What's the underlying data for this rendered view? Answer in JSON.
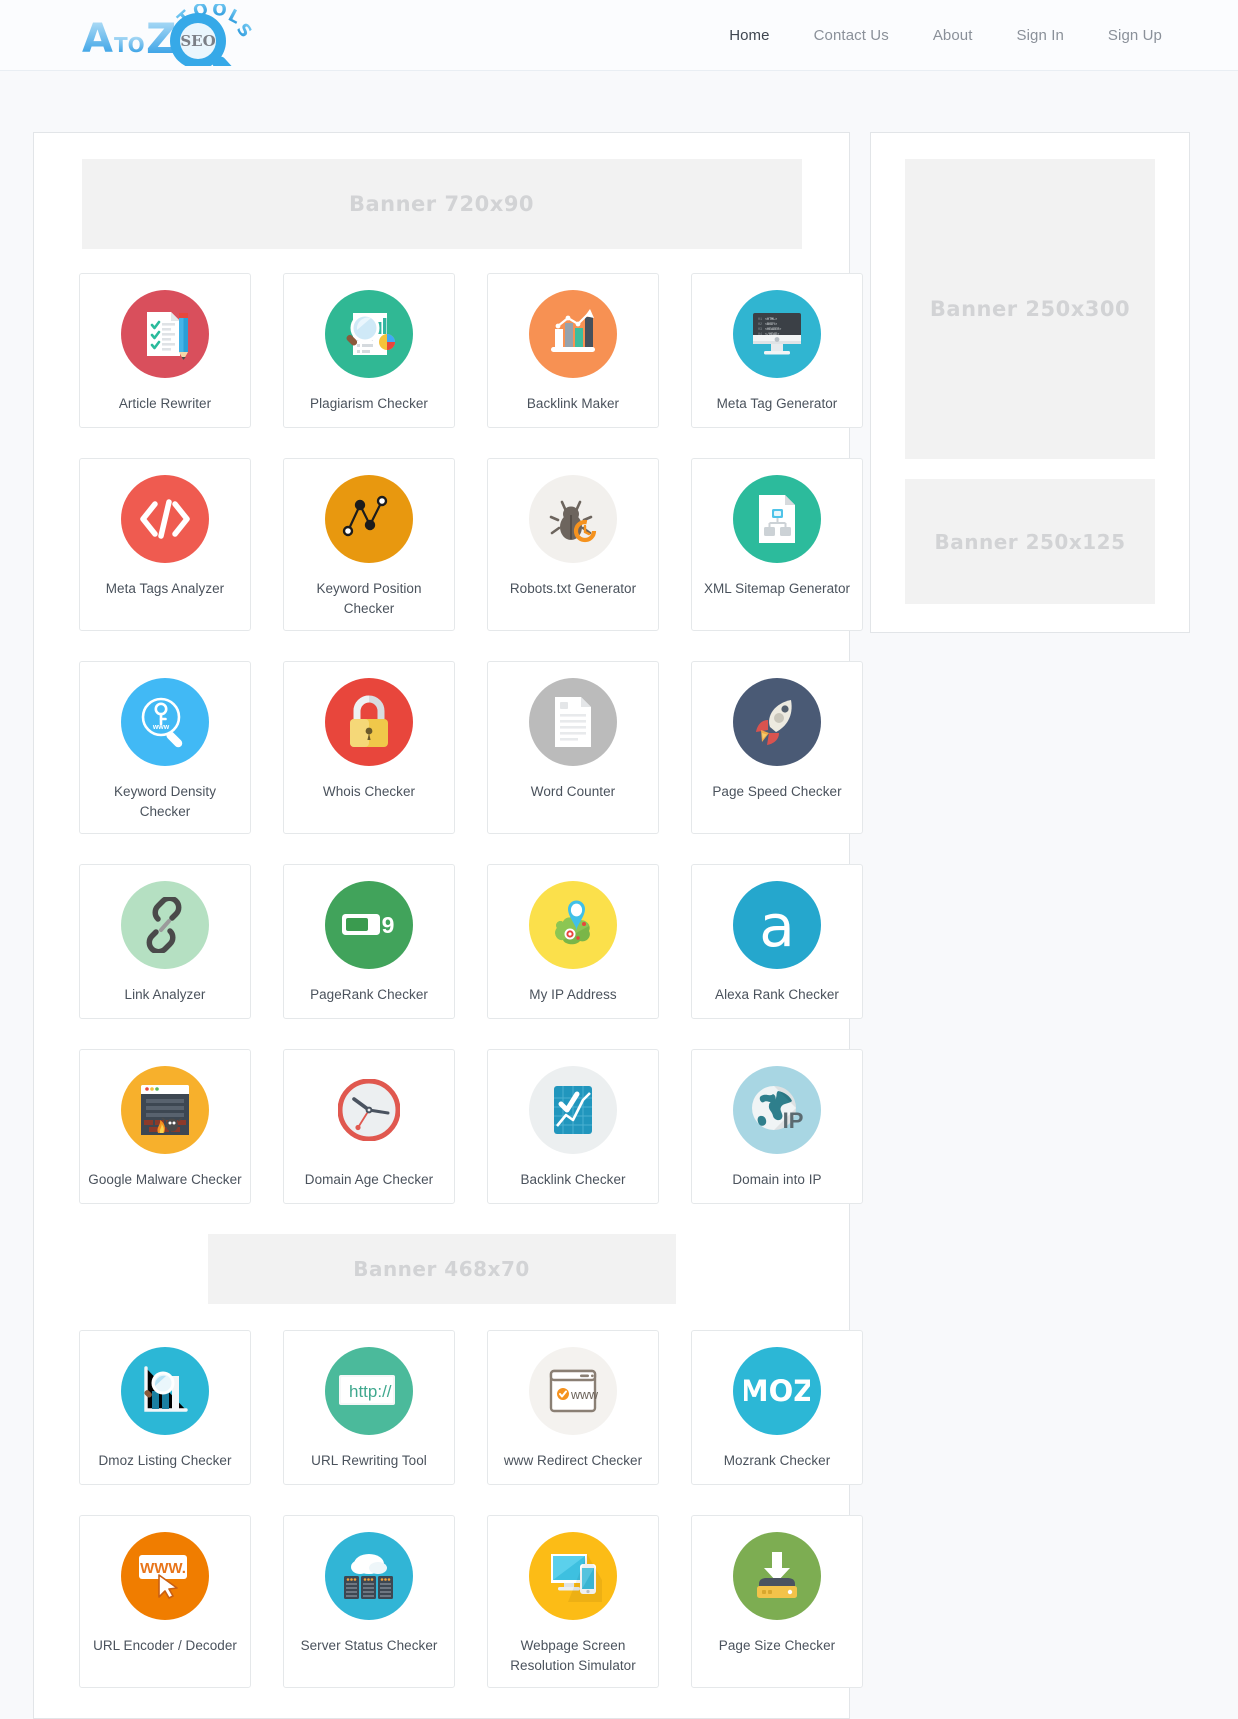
{
  "header": {
    "logo": {
      "alt": "A to Z SEO Tools",
      "text_a": "A",
      "text_to": "TO",
      "text_z": "Z",
      "badge": "SEO",
      "text_tools": "TOOLS"
    },
    "nav": [
      {
        "label": "Home",
        "active": true
      },
      {
        "label": "Contact Us",
        "active": false
      },
      {
        "label": "About",
        "active": false
      },
      {
        "label": "Sign In",
        "active": false
      },
      {
        "label": "Sign Up",
        "active": false
      }
    ],
    "accent_color": "#2cb5cd"
  },
  "main": {
    "banner_top": "Banner  720x90",
    "banner_mid": "Banner  468x70",
    "tools_group_1": [
      {
        "label": "Article Rewriter",
        "icon": "article-rewriter-icon",
        "bg": "#d94f5c"
      },
      {
        "label": "Plagiarism Checker",
        "icon": "plagiarism-checker-icon",
        "bg": "#30b894"
      },
      {
        "label": "Backlink Maker",
        "icon": "backlink-maker-icon",
        "bg": "#f79153"
      },
      {
        "label": "Meta Tag Generator",
        "icon": "meta-tag-generator-icon",
        "bg": "#30b5d1"
      },
      {
        "label": "Meta Tags Analyzer",
        "icon": "meta-tags-analyzer-icon",
        "bg": "#ef5b50"
      },
      {
        "label": "Keyword Position Checker",
        "icon": "keyword-position-checker-icon",
        "bg": "#e8980f"
      },
      {
        "label": "Robots.txt Generator",
        "icon": "robots-txt-generator-icon",
        "bg": "#f2f0ed"
      },
      {
        "label": "XML Sitemap Generator",
        "icon": "xml-sitemap-generator-icon",
        "bg": "#2cbb9c"
      },
      {
        "label": "Keyword Density Checker",
        "icon": "keyword-density-checker-icon",
        "bg": "#41b9f5"
      },
      {
        "label": "Whois Checker",
        "icon": "whois-checker-icon",
        "bg": "#e8463c"
      },
      {
        "label": "Word Counter",
        "icon": "word-counter-icon",
        "bg": "#bbbbbb"
      },
      {
        "label": "Page Speed Checker",
        "icon": "page-speed-checker-icon",
        "bg": "#4a5a75"
      },
      {
        "label": "Link Analyzer",
        "icon": "link-analyzer-icon",
        "bg": "#b5e0c2"
      },
      {
        "label": "PageRank Checker",
        "icon": "pagerank-checker-icon",
        "bg": "#41a35b"
      },
      {
        "label": "My IP Address",
        "icon": "my-ip-address-icon",
        "bg": "#fbe04b"
      },
      {
        "label": "Alexa Rank Checker",
        "icon": "alexa-rank-checker-icon",
        "bg": "#25a7cd"
      },
      {
        "label": "Google Malware Checker",
        "icon": "google-malware-checker-icon",
        "bg": "#f7b02c"
      },
      {
        "label": "Domain Age Checker",
        "icon": "domain-age-checker-icon",
        "bg": "#ffffff"
      },
      {
        "label": "Backlink Checker",
        "icon": "backlink-checker-icon",
        "bg": "#eceff0"
      },
      {
        "label": "Domain into IP",
        "icon": "domain-into-ip-icon",
        "bg": "#a8d6e3"
      }
    ],
    "tools_group_2": [
      {
        "label": "Dmoz Listing Checker",
        "icon": "dmoz-listing-checker-icon",
        "bg": "#2cb7d6"
      },
      {
        "label": "URL Rewriting Tool",
        "icon": "url-rewriting-tool-icon",
        "bg": "#4bba9b"
      },
      {
        "label": "www Redirect Checker",
        "icon": "www-redirect-checker-icon",
        "bg": "#f4f2ef"
      },
      {
        "label": "Mozrank Checker",
        "icon": "mozrank-checker-icon",
        "bg": "#2cb7d6"
      },
      {
        "label": "URL Encoder / Decoder",
        "icon": "url-encoder-decoder-icon",
        "bg": "#f07d00"
      },
      {
        "label": "Server Status Checker",
        "icon": "server-status-checker-icon",
        "bg": "#31b5d6"
      },
      {
        "label": "Webpage Screen Resolution Simulator",
        "icon": "webpage-screen-resolution-simulator-icon",
        "bg": "#fcbc16"
      },
      {
        "label": "Page Size Checker",
        "icon": "page-size-checker-icon",
        "bg": "#7dad52"
      }
    ]
  },
  "sidebar": {
    "banner_300": "Banner  250x300",
    "banner_125": "Banner  250x125"
  }
}
